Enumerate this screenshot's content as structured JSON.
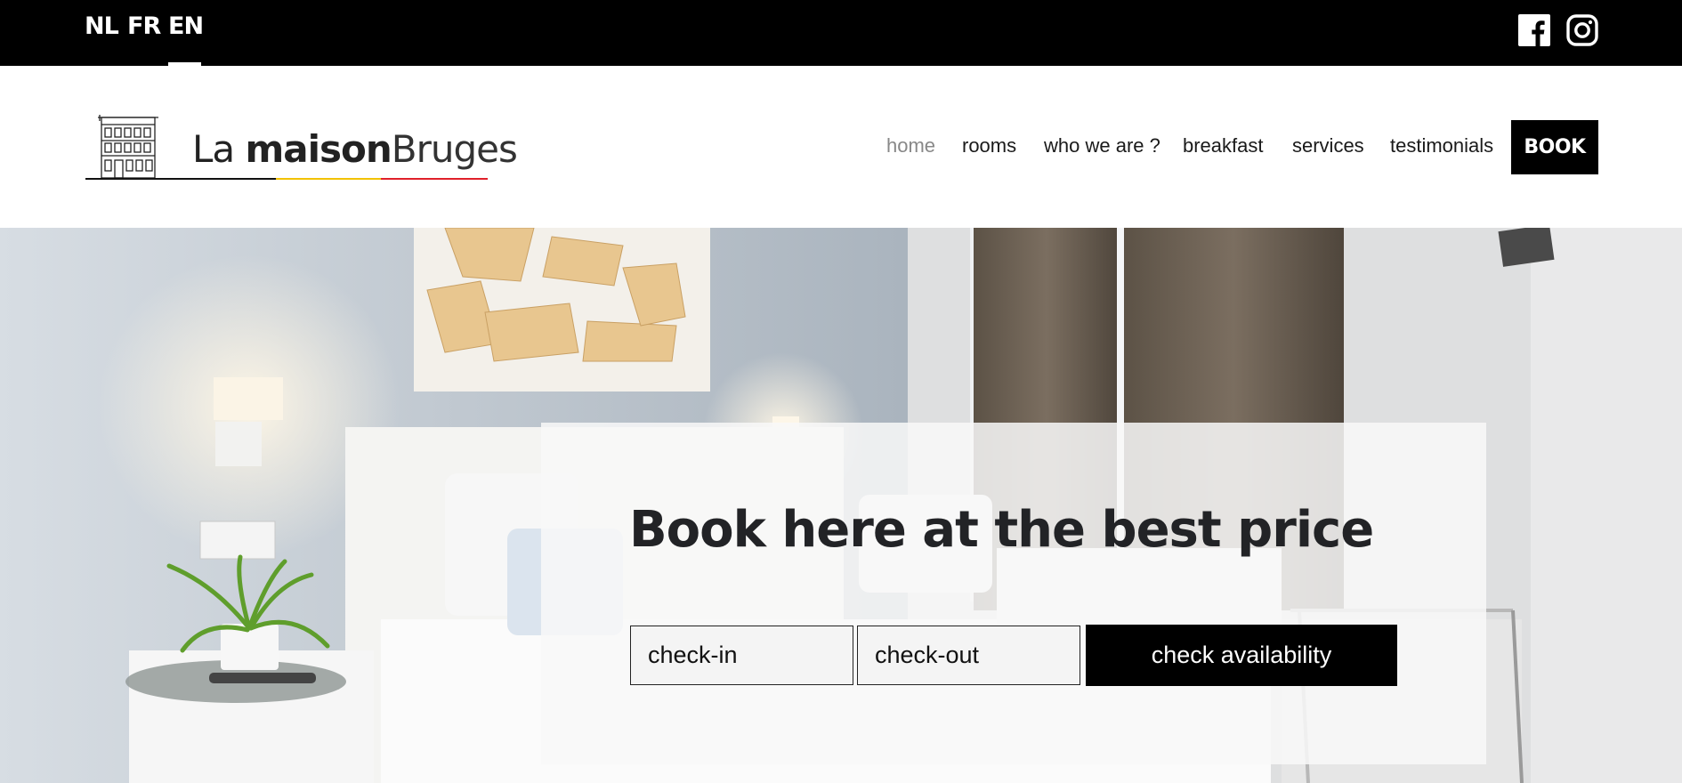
{
  "languages": [
    {
      "code": "NL",
      "active": false
    },
    {
      "code": "FR",
      "active": false
    },
    {
      "code": "EN",
      "active": true
    }
  ],
  "social": {
    "facebook_icon": "facebook-icon",
    "instagram_icon": "instagram-icon"
  },
  "logo": {
    "la": "La",
    "maison": "maison",
    "bruges": "Bruges",
    "flag_colors": [
      "#111111",
      "#f2c200",
      "#e0202a"
    ]
  },
  "nav": {
    "items": [
      "home",
      "rooms",
      "who we are ?",
      "breakfast",
      "services",
      "testimonials"
    ],
    "active": "home",
    "book_label": "BOOK"
  },
  "booking": {
    "headline": "Book here at the best price",
    "checkin_placeholder": "check-in",
    "checkout_placeholder": "check-out",
    "button_label": "check availability"
  },
  "colors": {
    "topbar": "#000000",
    "accent_button": "#000000",
    "nav_active": "#888888"
  }
}
